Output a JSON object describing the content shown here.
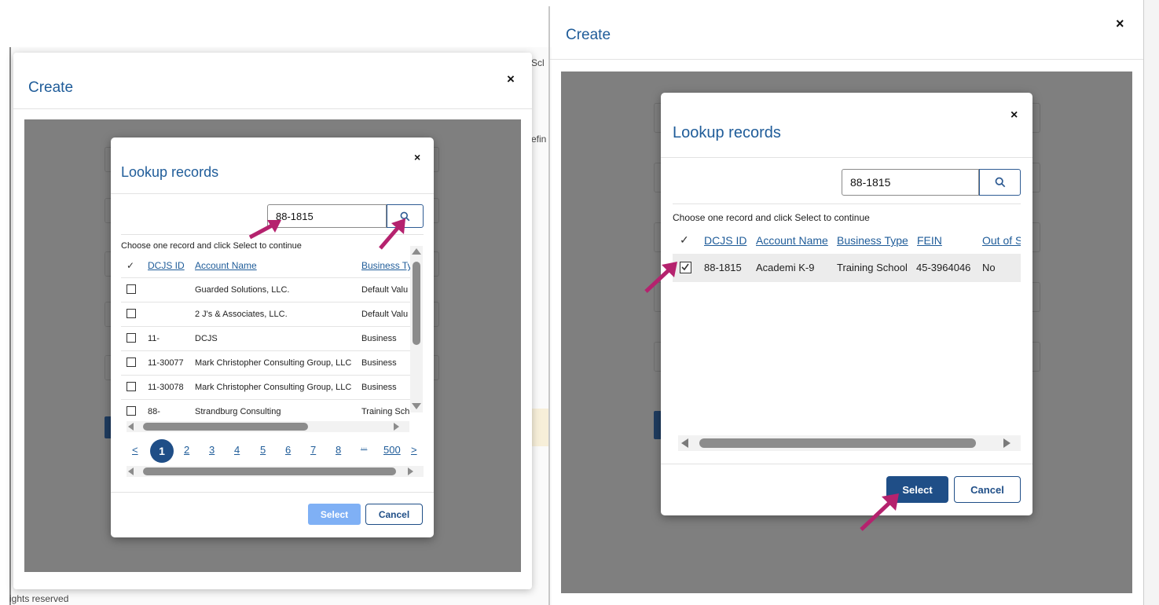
{
  "left_panel": {
    "dialog_title": "Create",
    "close_glyph": "×",
    "background_fragments": {
      "sc": "Scl",
      "efin": "efin"
    },
    "lookup": {
      "title": "Lookup records",
      "close_glyph": "×",
      "search_value": "88-1815",
      "instruction": "Choose one record and click Select to continue",
      "columns": [
        "DCJS ID",
        "Account Name",
        "Business Ty"
      ],
      "rows": [
        {
          "id": "",
          "name": "Guarded Solutions, LLC.",
          "type": "Default Valu"
        },
        {
          "id": "",
          "name": "2 J's & Associates, LLC.",
          "type": "Default Valu"
        },
        {
          "id": "11-",
          "name": "DCJS",
          "type": "Business"
        },
        {
          "id": "11-30077",
          "name": "Mark Christopher Consulting Group, LLC",
          "type": "Business"
        },
        {
          "id": "11-30078",
          "name": "Mark Christopher Consulting Group, LLC",
          "type": "Business"
        },
        {
          "id": "88-",
          "name": "Strandburg Consulting",
          "type": "Training Sch"
        }
      ],
      "pagination": {
        "prev": "<",
        "current": "1",
        "pages": [
          "2",
          "3",
          "4",
          "5",
          "6",
          "7",
          "8"
        ],
        "ellipsis": "...",
        "last": "500",
        "next": ">"
      },
      "select_label": "Select",
      "cancel_label": "Cancel"
    },
    "footer_fragment": "ights reserved"
  },
  "right_panel": {
    "dialog_title": "Create",
    "close_glyph": "×",
    "lookup": {
      "title": "Lookup records",
      "close_glyph": "×",
      "search_value": "88-1815",
      "instruction": "Choose one record and click Select to continue",
      "columns": [
        "DCJS ID",
        "Account Name",
        "Business Type",
        "FEIN",
        "Out of S"
      ],
      "rows": [
        {
          "id": "88-1815",
          "name": "Academi K-9",
          "type": "Training School",
          "fein": "45-3964046",
          "out_of_state": "No",
          "checked": true
        }
      ],
      "select_label": "Select",
      "cancel_label": "Cancel"
    }
  },
  "colors": {
    "accent": "#1f5c99",
    "primary_button": "#1f4e87",
    "disabled_button": "#7fb0f5",
    "annotation_arrow": "#b5226e",
    "backdrop": "#7f7f7f"
  },
  "icons": [
    "close-icon",
    "search-icon",
    "checkmark-icon",
    "checkbox-icon",
    "scroll-arrow-icon",
    "annotation-arrow-icon"
  ]
}
